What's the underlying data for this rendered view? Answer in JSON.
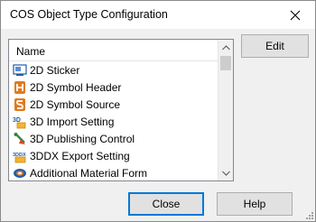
{
  "window": {
    "title": "COS Object Type Configuration"
  },
  "list": {
    "header": "Name",
    "items": [
      {
        "label": "2D Sticker",
        "icon": "sticker-icon"
      },
      {
        "label": "2D Symbol Header",
        "icon": "symbol-header-icon"
      },
      {
        "label": "2D Symbol Source",
        "icon": "symbol-source-icon"
      },
      {
        "label": "3D Import Setting",
        "icon": "3d-import-icon"
      },
      {
        "label": "3D Publishing Control",
        "icon": "3d-publishing-icon"
      },
      {
        "label": "3DDX Export Setting",
        "icon": "3ddx-export-icon"
      },
      {
        "label": "Additional Material Form",
        "icon": "material-form-icon"
      }
    ]
  },
  "buttons": {
    "edit": "Edit",
    "close": "Close",
    "help": "Help"
  },
  "colors": {
    "accent": "#0078d7",
    "icon_orange": "#e07a1f",
    "icon_blue": "#1f5fae"
  }
}
